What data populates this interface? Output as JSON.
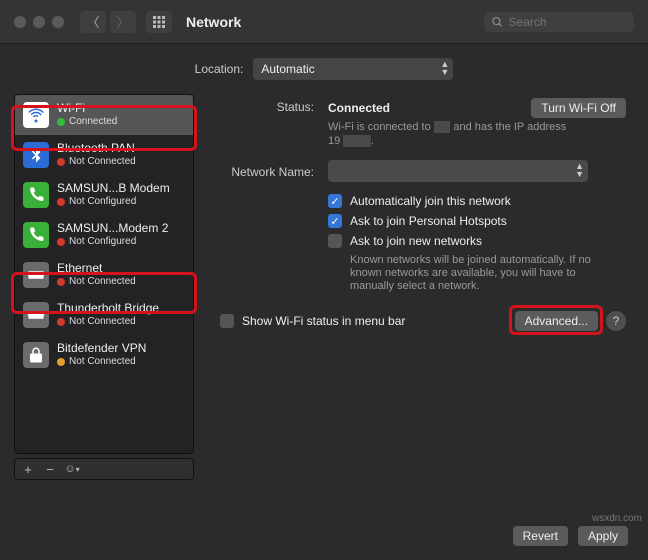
{
  "window": {
    "title": "Network",
    "search_placeholder": "Search"
  },
  "location": {
    "label": "Location:",
    "value": "Automatic"
  },
  "sidebar": {
    "items": [
      {
        "name": "Wi-Fi",
        "status": "Connected",
        "dot": "#2fbf3a",
        "icon": "wifi",
        "iconbg": "#ffffff",
        "iconfg": "#2a6bd6",
        "selected": true
      },
      {
        "name": "Bluetooth PAN",
        "status": "Not Connected",
        "dot": "#d23a2e",
        "icon": "bluetooth",
        "iconbg": "#2a6bd6",
        "iconfg": "#ffffff"
      },
      {
        "name": "SAMSUN...B Modem",
        "status": "Not Configured",
        "dot": "#d23a2e",
        "icon": "phone",
        "iconbg": "#39b037",
        "iconfg": "#ffffff"
      },
      {
        "name": "SAMSUN...Modem 2",
        "status": "Not Configured",
        "dot": "#d23a2e",
        "icon": "phone",
        "iconbg": "#39b037",
        "iconfg": "#ffffff"
      },
      {
        "name": "Ethernet",
        "status": "Not Connected",
        "dot": "#d23a2e",
        "icon": "ethernet",
        "iconbg": "#6b6b6d",
        "iconfg": "#ffffff"
      },
      {
        "name": "Thunderbolt Bridge",
        "status": "Not Connected",
        "dot": "#d23a2e",
        "icon": "ethernet",
        "iconbg": "#6b6b6d",
        "iconfg": "#ffffff"
      },
      {
        "name": "Bitdefender VPN",
        "status": "Not Connected",
        "dot": "#e0a030",
        "icon": "lock",
        "iconbg": "#6b6b6d",
        "iconfg": "#ffffff"
      }
    ]
  },
  "detail": {
    "status_label": "Status:",
    "status_value": "Connected",
    "turn_off": "Turn Wi-Fi Off",
    "status_hint_a": "Wi-Fi is connected to",
    "status_hint_b": "and has the IP address 19",
    "name_label": "Network Name:",
    "name_value": "",
    "auto_join": "Automatically join this network",
    "ask_hotspots": "Ask to join Personal Hotspots",
    "ask_new": "Ask to join new networks",
    "ask_new_help": "Known networks will be joined automatically. If no known networks are available, you will have to manually select a network.",
    "show_status": "Show Wi-Fi status in menu bar",
    "advanced": "Advanced..."
  },
  "footer": {
    "revert": "Revert",
    "apply": "Apply"
  },
  "watermark": "wsxdn.com"
}
